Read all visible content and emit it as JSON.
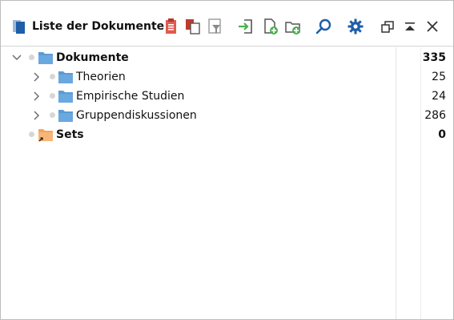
{
  "window": {
    "title": "Liste der Dokumente"
  },
  "toolbar": {
    "buttons": [
      {
        "name": "clipboard-icon",
        "color": "#d9534f"
      },
      {
        "name": "copy-documents-icon",
        "color": "#c0392b"
      },
      {
        "name": "filter-icon",
        "color": "#8a8a8a"
      },
      {
        "name": "import-icon",
        "color": "#4caf50"
      },
      {
        "name": "new-document-icon",
        "color": "#4caf50"
      },
      {
        "name": "new-folder-icon",
        "color": "#4caf50"
      },
      {
        "name": "search-icon",
        "color": "#1f5ea8"
      },
      {
        "name": "gear-icon",
        "color": "#1f5ea8"
      }
    ],
    "window_controls": [
      "undock-icon",
      "collapse-icon",
      "close-icon"
    ]
  },
  "tree": {
    "root": {
      "label": "Dokumente",
      "count": "335"
    },
    "children": [
      {
        "label": "Theorien",
        "count": "25"
      },
      {
        "label": "Empirische Studien",
        "count": "24"
      },
      {
        "label": "Gruppendiskussionen",
        "count": "286"
      }
    ],
    "sets": {
      "label": "Sets",
      "count": "0"
    }
  },
  "colors": {
    "folder_blue": "#5b9bd5",
    "folder_orange": "#f5a45d",
    "accent_blue": "#1f5ea8"
  }
}
